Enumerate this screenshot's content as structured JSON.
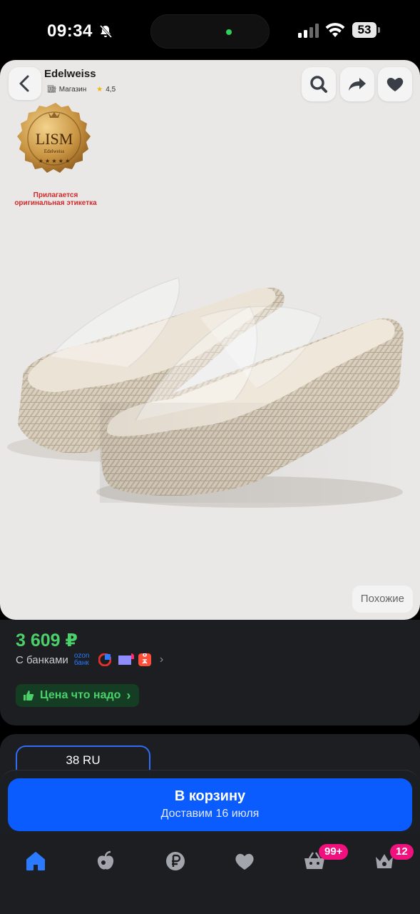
{
  "status_bar": {
    "time": "09:34",
    "battery": "53"
  },
  "product": {
    "store_name": "Edelweiss",
    "store_type": "Магазин",
    "rating": "4,5",
    "seal": {
      "brand": "LISM",
      "sub": "Edelweiss"
    },
    "label_note_line1": "Прилагается",
    "label_note_line2": "оригинальная этикетка",
    "similar_label": "Похожие"
  },
  "pricing": {
    "price": "3 609 ₽",
    "banks_label": "С банками",
    "ozon_bank_line1": "ozon",
    "ozon_bank_line2": "банк",
    "deal_label": "Цена что надо"
  },
  "size": {
    "selected": "38 RU"
  },
  "cart": {
    "title": "В корзину",
    "subtitle": "Доставим 16 июля"
  },
  "tab_bar": {
    "cart_badge": "99+",
    "profile_badge": "12"
  },
  "colors": {
    "accent_blue": "#0b5cff",
    "price_green": "#4bd06a",
    "badge_pink": "#f1117e",
    "panel_bg": "#1c1e22"
  }
}
